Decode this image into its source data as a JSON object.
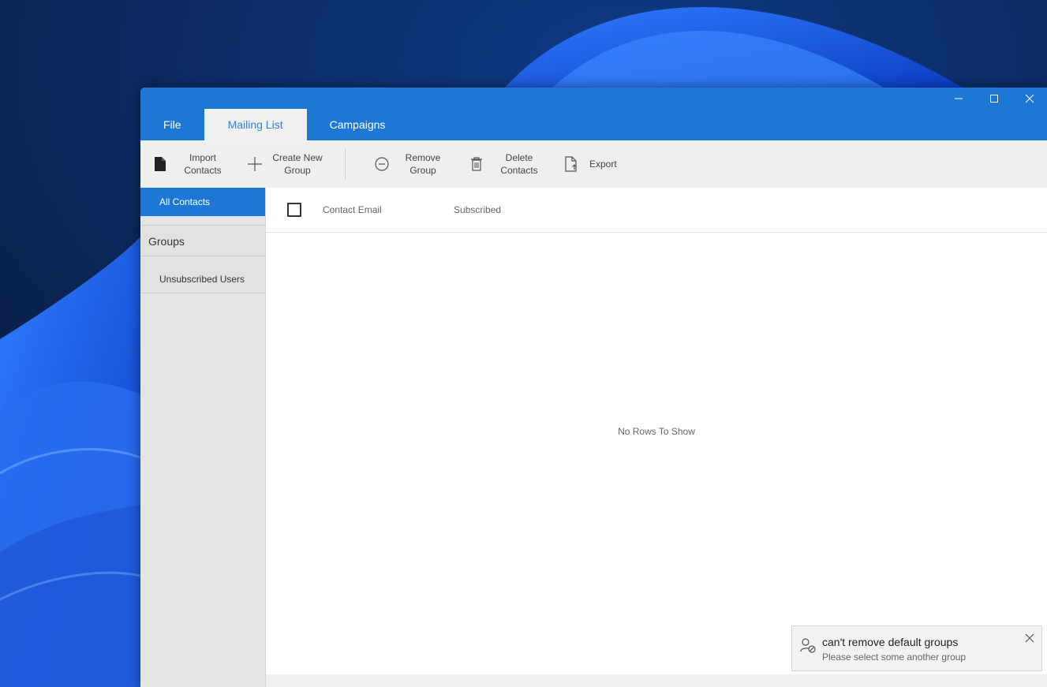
{
  "window": {
    "tabs": [
      {
        "label": "File"
      },
      {
        "label": "Mailing List"
      },
      {
        "label": "Campaigns"
      }
    ],
    "active_tab": "Mailing List"
  },
  "ribbon": {
    "import_contacts": "Import\nContacts",
    "create_new_group": "Create New\nGroup",
    "remove_group": "Remove\nGroup",
    "delete_contacts": "Delete\nContacts",
    "export": "Export"
  },
  "sidebar": {
    "all_contacts": "All Contacts",
    "groups": "Groups",
    "unsubscribed_users": "Unsubscribed Users"
  },
  "grid": {
    "columns": [
      "Contact Email",
      "Subscribed"
    ],
    "empty_message": "No Rows To Show"
  },
  "toast": {
    "title": "can't remove default groups",
    "message": "Please select some another group"
  },
  "colors": {
    "accent": "#1c78d4",
    "active_tab_text": "#3a7fd5"
  }
}
